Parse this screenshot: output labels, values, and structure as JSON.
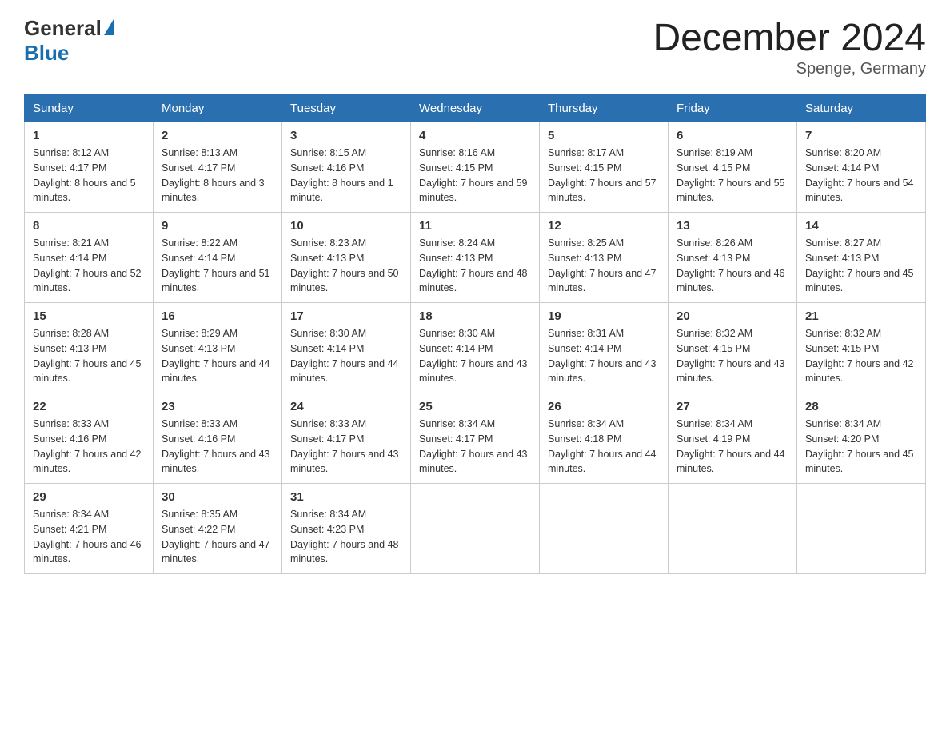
{
  "logo": {
    "general": "General",
    "blue": "Blue"
  },
  "title": "December 2024",
  "location": "Spenge, Germany",
  "days_of_week": [
    "Sunday",
    "Monday",
    "Tuesday",
    "Wednesday",
    "Thursday",
    "Friday",
    "Saturday"
  ],
  "weeks": [
    [
      {
        "day": "1",
        "sunrise": "8:12 AM",
        "sunset": "4:17 PM",
        "daylight": "8 hours and 5 minutes."
      },
      {
        "day": "2",
        "sunrise": "8:13 AM",
        "sunset": "4:17 PM",
        "daylight": "8 hours and 3 minutes."
      },
      {
        "day": "3",
        "sunrise": "8:15 AM",
        "sunset": "4:16 PM",
        "daylight": "8 hours and 1 minute."
      },
      {
        "day": "4",
        "sunrise": "8:16 AM",
        "sunset": "4:15 PM",
        "daylight": "7 hours and 59 minutes."
      },
      {
        "day": "5",
        "sunrise": "8:17 AM",
        "sunset": "4:15 PM",
        "daylight": "7 hours and 57 minutes."
      },
      {
        "day": "6",
        "sunrise": "8:19 AM",
        "sunset": "4:15 PM",
        "daylight": "7 hours and 55 minutes."
      },
      {
        "day": "7",
        "sunrise": "8:20 AM",
        "sunset": "4:14 PM",
        "daylight": "7 hours and 54 minutes."
      }
    ],
    [
      {
        "day": "8",
        "sunrise": "8:21 AM",
        "sunset": "4:14 PM",
        "daylight": "7 hours and 52 minutes."
      },
      {
        "day": "9",
        "sunrise": "8:22 AM",
        "sunset": "4:14 PM",
        "daylight": "7 hours and 51 minutes."
      },
      {
        "day": "10",
        "sunrise": "8:23 AM",
        "sunset": "4:13 PM",
        "daylight": "7 hours and 50 minutes."
      },
      {
        "day": "11",
        "sunrise": "8:24 AM",
        "sunset": "4:13 PM",
        "daylight": "7 hours and 48 minutes."
      },
      {
        "day": "12",
        "sunrise": "8:25 AM",
        "sunset": "4:13 PM",
        "daylight": "7 hours and 47 minutes."
      },
      {
        "day": "13",
        "sunrise": "8:26 AM",
        "sunset": "4:13 PM",
        "daylight": "7 hours and 46 minutes."
      },
      {
        "day": "14",
        "sunrise": "8:27 AM",
        "sunset": "4:13 PM",
        "daylight": "7 hours and 45 minutes."
      }
    ],
    [
      {
        "day": "15",
        "sunrise": "8:28 AM",
        "sunset": "4:13 PM",
        "daylight": "7 hours and 45 minutes."
      },
      {
        "day": "16",
        "sunrise": "8:29 AM",
        "sunset": "4:13 PM",
        "daylight": "7 hours and 44 minutes."
      },
      {
        "day": "17",
        "sunrise": "8:30 AM",
        "sunset": "4:14 PM",
        "daylight": "7 hours and 44 minutes."
      },
      {
        "day": "18",
        "sunrise": "8:30 AM",
        "sunset": "4:14 PM",
        "daylight": "7 hours and 43 minutes."
      },
      {
        "day": "19",
        "sunrise": "8:31 AM",
        "sunset": "4:14 PM",
        "daylight": "7 hours and 43 minutes."
      },
      {
        "day": "20",
        "sunrise": "8:32 AM",
        "sunset": "4:15 PM",
        "daylight": "7 hours and 43 minutes."
      },
      {
        "day": "21",
        "sunrise": "8:32 AM",
        "sunset": "4:15 PM",
        "daylight": "7 hours and 42 minutes."
      }
    ],
    [
      {
        "day": "22",
        "sunrise": "8:33 AM",
        "sunset": "4:16 PM",
        "daylight": "7 hours and 42 minutes."
      },
      {
        "day": "23",
        "sunrise": "8:33 AM",
        "sunset": "4:16 PM",
        "daylight": "7 hours and 43 minutes."
      },
      {
        "day": "24",
        "sunrise": "8:33 AM",
        "sunset": "4:17 PM",
        "daylight": "7 hours and 43 minutes."
      },
      {
        "day": "25",
        "sunrise": "8:34 AM",
        "sunset": "4:17 PM",
        "daylight": "7 hours and 43 minutes."
      },
      {
        "day": "26",
        "sunrise": "8:34 AM",
        "sunset": "4:18 PM",
        "daylight": "7 hours and 44 minutes."
      },
      {
        "day": "27",
        "sunrise": "8:34 AM",
        "sunset": "4:19 PM",
        "daylight": "7 hours and 44 minutes."
      },
      {
        "day": "28",
        "sunrise": "8:34 AM",
        "sunset": "4:20 PM",
        "daylight": "7 hours and 45 minutes."
      }
    ],
    [
      {
        "day": "29",
        "sunrise": "8:34 AM",
        "sunset": "4:21 PM",
        "daylight": "7 hours and 46 minutes."
      },
      {
        "day": "30",
        "sunrise": "8:35 AM",
        "sunset": "4:22 PM",
        "daylight": "7 hours and 47 minutes."
      },
      {
        "day": "31",
        "sunrise": "8:34 AM",
        "sunset": "4:23 PM",
        "daylight": "7 hours and 48 minutes."
      },
      null,
      null,
      null,
      null
    ]
  ],
  "labels": {
    "sunrise": "Sunrise:",
    "sunset": "Sunset:",
    "daylight": "Daylight:"
  }
}
